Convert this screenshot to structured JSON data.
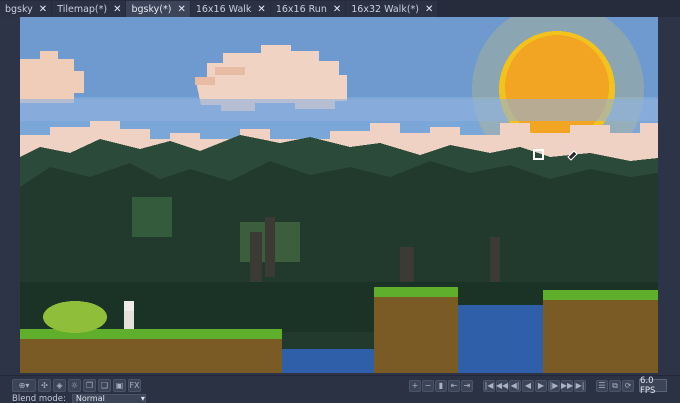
{
  "tabs": [
    {
      "label": "bgsky",
      "close": "✕",
      "active": false
    },
    {
      "label": "Tilemap(*)",
      "close": "✕",
      "active": false
    },
    {
      "label": "bgsky(*)",
      "close": "✕",
      "active": true
    },
    {
      "label": "16x16 Walk",
      "close": "✕",
      "active": false
    },
    {
      "label": "16x16 Run",
      "close": "✕",
      "active": false
    },
    {
      "label": "16x32 Walk(*)",
      "close": "✕",
      "active": false
    }
  ],
  "toolbar": {
    "left_buttons": [
      "layer-lock-icon",
      "move-icon",
      "transform-icon",
      "light-icon",
      "copy-icon",
      "paste-icon",
      "onion-icon"
    ],
    "left_labels": [
      "⊕▾",
      "✣",
      "◈",
      "☼",
      "❐",
      "❑",
      "▣",
      "FX"
    ],
    "blend_label": "Blend mode:",
    "blend_value": "Normal",
    "right_labels": [
      "+",
      "−",
      "▮",
      "⇤",
      "⇥",
      "|◀",
      "◀◀",
      "◀|",
      "◀",
      "▶",
      "|▶",
      "▶▶",
      "▶|",
      "☰",
      "⧉",
      "⟳"
    ],
    "fps": "6.0 FPS"
  },
  "colors": {
    "sky": "#6f97c9",
    "sun": "#f6a623",
    "cloud": "#f1d3c3",
    "grass": "#5fae2c",
    "water": "#2f5fa8",
    "forest": "#1f3a2c"
  }
}
